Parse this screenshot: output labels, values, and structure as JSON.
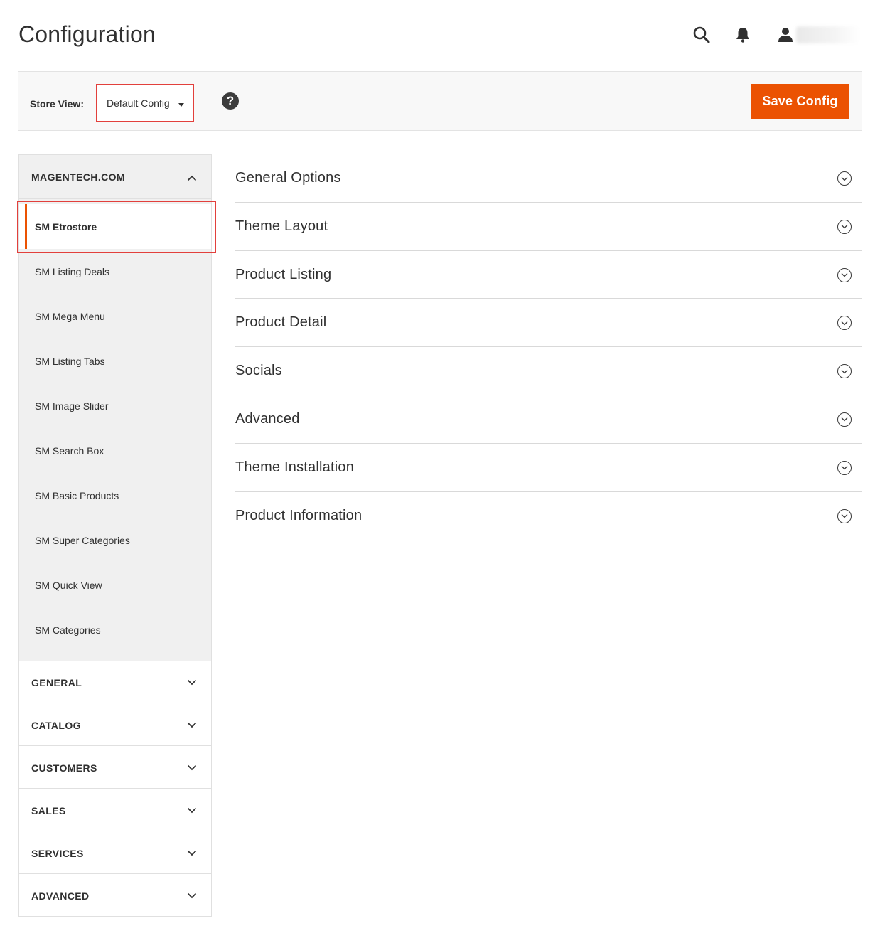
{
  "header": {
    "title": "Configuration",
    "icons": [
      "search-icon",
      "bell-icon",
      "user-icon"
    ]
  },
  "toolbar": {
    "store_view_label": "Store View:",
    "store_view_value": "Default Config",
    "help_glyph": "?",
    "save_label": "Save Config"
  },
  "sidebar": {
    "magentech": {
      "title": "MAGENTECH.COM",
      "items": [
        {
          "label": "SM Etrostore"
        },
        {
          "label": "SM Listing Deals"
        },
        {
          "label": "SM Mega Menu"
        },
        {
          "label": "SM Listing Tabs"
        },
        {
          "label": "SM Image Slider"
        },
        {
          "label": "SM Search Box"
        },
        {
          "label": "SM Basic Products"
        },
        {
          "label": "SM Super Categories"
        },
        {
          "label": "SM Quick View"
        },
        {
          "label": "SM Categories"
        }
      ]
    },
    "groups": [
      {
        "label": "GENERAL"
      },
      {
        "label": "CATALOG"
      },
      {
        "label": "CUSTOMERS"
      },
      {
        "label": "SALES"
      },
      {
        "label": "SERVICES"
      },
      {
        "label": "ADVANCED"
      }
    ]
  },
  "main": {
    "sections": [
      {
        "label": "General Options"
      },
      {
        "label": "Theme Layout"
      },
      {
        "label": "Product Listing"
      },
      {
        "label": "Product Detail"
      },
      {
        "label": "Socials"
      },
      {
        "label": "Advanced"
      },
      {
        "label": "Theme Installation"
      },
      {
        "label": "Product Information"
      }
    ]
  },
  "colors": {
    "accent": "#eb5202",
    "highlight_outline": "#e2403c",
    "sidebar_bg": "#f0f0f0",
    "toolbar_bg": "#f8f8f8",
    "text": "#303030"
  }
}
